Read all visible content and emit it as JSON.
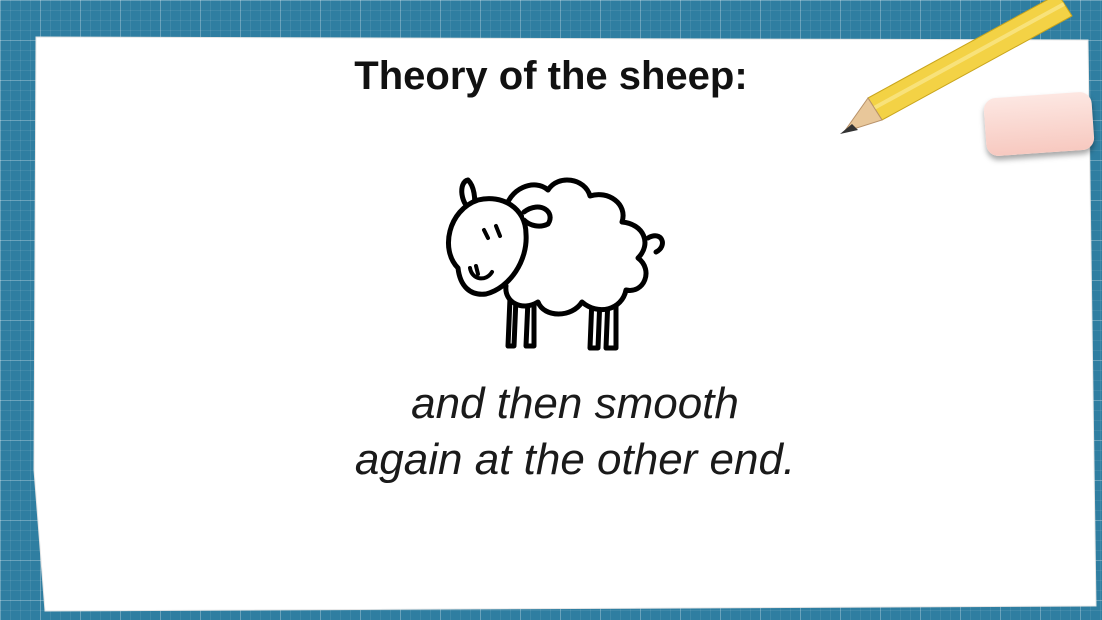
{
  "slide": {
    "title": "Theory of the sheep:",
    "caption_line1": "and then smooth",
    "caption_line2": "again at the other end."
  },
  "decor": {
    "background": "blue-grid",
    "icons": [
      "sheep-drawing",
      "pencil-icon",
      "eraser-icon"
    ],
    "colors": {
      "board": "#2f7ea1",
      "paper": "#ffffff",
      "pencil": "#f3d245",
      "eraser": "#f7c9c0"
    }
  }
}
